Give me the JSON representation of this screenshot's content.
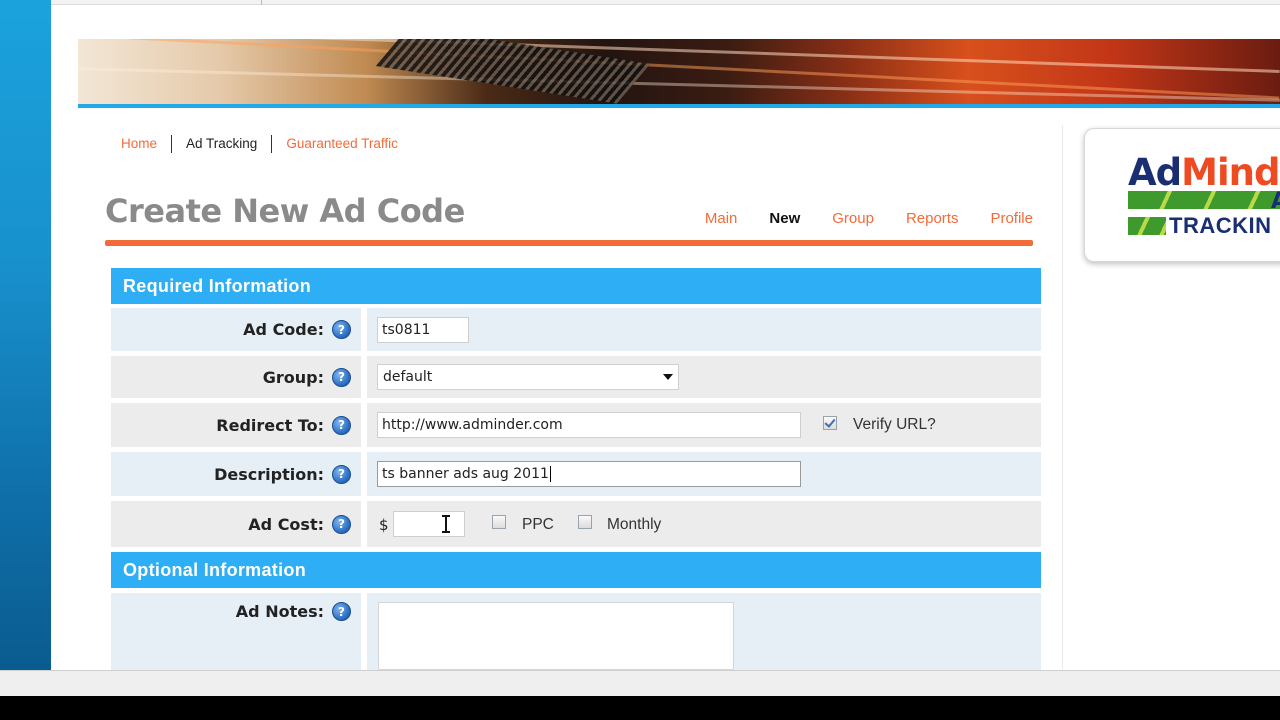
{
  "breadcrumb": {
    "items": [
      {
        "label": "Home",
        "style": "link"
      },
      {
        "label": "Ad Tracking",
        "style": "current"
      },
      {
        "label": "Guaranteed Traffic",
        "style": "link"
      }
    ]
  },
  "page": {
    "title": "Create New Ad Code"
  },
  "subnav": {
    "items": [
      {
        "label": "Main",
        "active": false
      },
      {
        "label": "New",
        "active": true
      },
      {
        "label": "Group",
        "active": false
      },
      {
        "label": "Reports",
        "active": false
      },
      {
        "label": "Profile",
        "active": false
      }
    ]
  },
  "sections": {
    "required": {
      "title": "Required Information"
    },
    "optional": {
      "title": "Optional Information"
    }
  },
  "form": {
    "ad_code": {
      "label": "Ad Code:",
      "value": "ts0811"
    },
    "group": {
      "label": "Group:",
      "selected": "default"
    },
    "redirect": {
      "label": "Redirect To:",
      "value": "http://www.adminder.com",
      "verify_label": "Verify URL?",
      "verify_checked": true
    },
    "description": {
      "label": "Description:",
      "value": "ts banner ads aug 2011"
    },
    "ad_cost": {
      "label": "Ad Cost:",
      "currency": "$",
      "value": "",
      "ppc_label": "PPC",
      "monthly_label": "Monthly",
      "ppc_checked": false,
      "monthly_checked": false
    },
    "ad_notes": {
      "label": "Ad Notes:",
      "value": ""
    }
  },
  "help_icon_glyph": "?",
  "logo": {
    "word_a": "Ad",
    "word_b": "Minde",
    "line2": "A",
    "line3": "TRACKIN"
  },
  "colors": {
    "accent_orange": "#f26b3a",
    "section_blue": "#2eaef5",
    "logo_navy": "#1a2e73",
    "logo_red": "#ef4b23",
    "logo_green": "#3f9a2e"
  }
}
